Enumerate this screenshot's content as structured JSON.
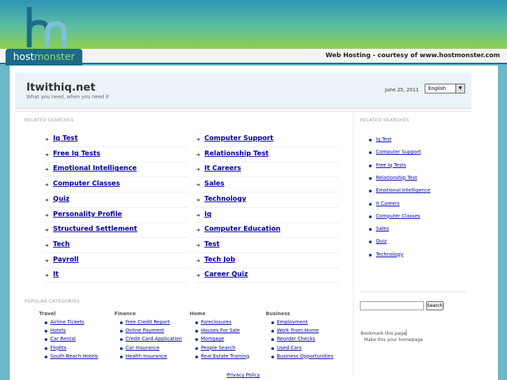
{
  "brand": {
    "host": "host",
    "monster": "monster",
    "tagline": "Web Hosting - courtesy of www.hostmonster.com"
  },
  "site": {
    "title": "ltwithiq.net",
    "subtitle": "What you need, when you need it",
    "date": "June 25, 2011",
    "language": "English"
  },
  "labels": {
    "related_searches": "RELATED SEARCHES",
    "popular_categories": "POPULAR CATEGORIES",
    "search_button": "Search",
    "bookmark": "Bookmark this page",
    "homepage": "Make this your homepage",
    "privacy": "Privacy Policy"
  },
  "related_left": [
    "Iq Test",
    "Free Iq Tests",
    "Emotional Intelligence",
    "Computer Classes",
    "Quiz",
    "Personality Profile",
    "Structured Settlement",
    "Tech",
    "Payroll",
    "It"
  ],
  "related_right": [
    "Computer Support",
    "Relationship Test",
    "It Careers",
    "Sales",
    "Technology",
    "Iq",
    "Computer Education",
    "Test",
    "Tech Job",
    "Career Quiz"
  ],
  "sidebar_related": [
    "Iq Test",
    "Computer Support",
    "Free Iq Tests",
    "Relationship Test",
    "Emotional Intelligence",
    "It Careers",
    "Computer Classes",
    "Sales",
    "Quiz",
    "Technology"
  ],
  "categories": [
    {
      "name": "Travel",
      "links": [
        "Airline Tickets",
        "Hotels",
        "Car Rental",
        "Flights",
        "South Beach Hotels"
      ]
    },
    {
      "name": "Finance",
      "links": [
        "Free Credit Report",
        "Online Payment",
        "Credit Card Application",
        "Car Insurance",
        "Health Insurance"
      ]
    },
    {
      "name": "Home",
      "links": [
        "Foreclosures",
        "Houses For Sale",
        "Mortgage",
        "People Search",
        "Real Estate Training"
      ]
    },
    {
      "name": "Business",
      "links": [
        "Employment",
        "Work From Home",
        "Reorder Checks",
        "Used Cars",
        "Business Opportunities"
      ]
    }
  ]
}
